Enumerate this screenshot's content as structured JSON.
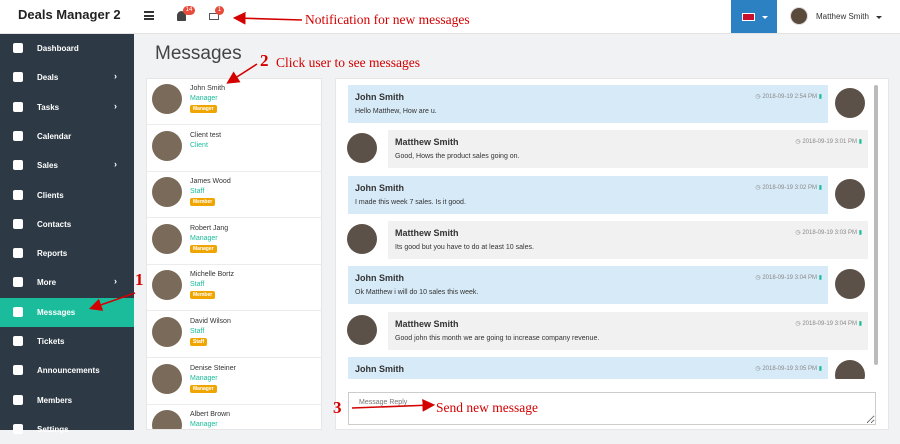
{
  "app": {
    "brand": "Deals Manager 2"
  },
  "topbar": {
    "bell_count": "14",
    "mail_count": "1",
    "user_name": "Matthew Smith"
  },
  "sidebar": {
    "items": [
      {
        "label": "Dashboard",
        "icon": "dashboard-icon",
        "chevron": ""
      },
      {
        "label": "Deals",
        "icon": "rocket-icon",
        "chevron": "›"
      },
      {
        "label": "Tasks",
        "icon": "list-icon",
        "chevron": "›"
      },
      {
        "label": "Calendar",
        "icon": "calendar-icon",
        "chevron": ""
      },
      {
        "label": "Sales",
        "icon": "cart-icon",
        "chevron": "›"
      },
      {
        "label": "Clients",
        "icon": "building-icon",
        "chevron": ""
      },
      {
        "label": "Contacts",
        "icon": "users-icon",
        "chevron": ""
      },
      {
        "label": "Reports",
        "icon": "chart-icon",
        "chevron": ""
      },
      {
        "label": "More",
        "icon": "gear-icon",
        "chevron": "›"
      },
      {
        "label": "Messages",
        "icon": "envelope-icon",
        "chevron": "",
        "active": true
      },
      {
        "label": "Tickets",
        "icon": "ticket-icon",
        "chevron": ""
      },
      {
        "label": "Announcements",
        "icon": "bullhorn-icon",
        "chevron": ""
      },
      {
        "label": "Members",
        "icon": "user-icon",
        "chevron": ""
      },
      {
        "label": "Settings",
        "icon": "cog-icon",
        "chevron": ""
      }
    ]
  },
  "main": {
    "title": "Messages"
  },
  "users": [
    {
      "name": "John Smith",
      "role": "Manager",
      "badge": "Manager"
    },
    {
      "name": "Client test",
      "role": "Client",
      "badge": ""
    },
    {
      "name": "James Wood",
      "role": "Staff",
      "badge": "Member"
    },
    {
      "name": "Robert Jang",
      "role": "Manager",
      "badge": "Manager"
    },
    {
      "name": "Michelle Bortz",
      "role": "Staff",
      "badge": "Member"
    },
    {
      "name": "David Wilson",
      "role": "Staff",
      "badge": "Staff"
    },
    {
      "name": "Denise Steiner",
      "role": "Manager",
      "badge": "Manager"
    },
    {
      "name": "Albert Brown",
      "role": "Manager",
      "badge": ""
    }
  ],
  "messages": [
    {
      "sender": "John Smith",
      "time": "2018-09-19 2:54 PM",
      "text": "Hello Matthew, How are u.",
      "side": "in"
    },
    {
      "sender": "Matthew Smith",
      "time": "2018-09-19 3:01 PM",
      "text": "Good, Hows the product sales going on.",
      "side": "out"
    },
    {
      "sender": "John Smith",
      "time": "2018-09-19 3:02 PM",
      "text": "I made this week 7 sales. Is it good.",
      "side": "in"
    },
    {
      "sender": "Matthew Smith",
      "time": "2018-09-19 3:03 PM",
      "text": "Its good but you have to do at least 10 sales.",
      "side": "out"
    },
    {
      "sender": "John Smith",
      "time": "2018-09-19 3:04 PM",
      "text": "Ok Matthew i will do 10 sales this week.",
      "side": "in"
    },
    {
      "sender": "Matthew Smith",
      "time": "2018-09-19 3:04 PM",
      "text": "Good john this month we are going to increase company revenue.",
      "side": "out"
    },
    {
      "sender": "John Smith",
      "time": "2018-09-19 3:05 PM",
      "text": "",
      "side": "in"
    }
  ],
  "reply": {
    "placeholder": "Message Reply"
  },
  "annotations": {
    "a0_text": "Notification for new messages",
    "a1_num": "1",
    "a2_num": "2",
    "a2_text": "Click user to see messages",
    "a3_num": "3",
    "a3_text": "Send new message"
  },
  "colors": {
    "sidebar": "#2d3a45",
    "active": "#1abc9c",
    "accent": "#2b81c2",
    "annotation": "#d40000"
  }
}
